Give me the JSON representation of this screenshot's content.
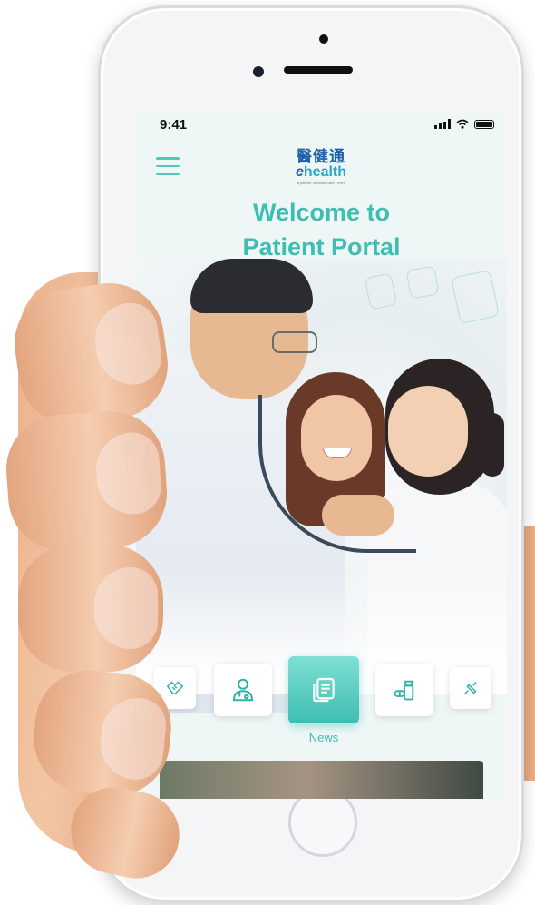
{
  "status_bar": {
    "time": "9:41"
  },
  "header": {
    "logo_chinese": "醫健通",
    "logo_english": "health",
    "logo_english_prefix": "e",
    "logo_tagline": "a partner in health care / eHR"
  },
  "hero": {
    "line1": "Welcome to",
    "line2": "Patient Portal"
  },
  "quick_tiles": [
    {
      "icon": "handshake-icon",
      "active": false
    },
    {
      "icon": "doctor-icon",
      "active": false
    },
    {
      "icon": "news-icon",
      "active": true,
      "label": "News"
    },
    {
      "icon": "medication-icon",
      "active": false
    },
    {
      "icon": "syringe-icon",
      "active": false
    }
  ],
  "colors": {
    "accent": "#3fbdb2",
    "logo_blue": "#1f5fa6",
    "tile_active": "#5dcfc3"
  }
}
